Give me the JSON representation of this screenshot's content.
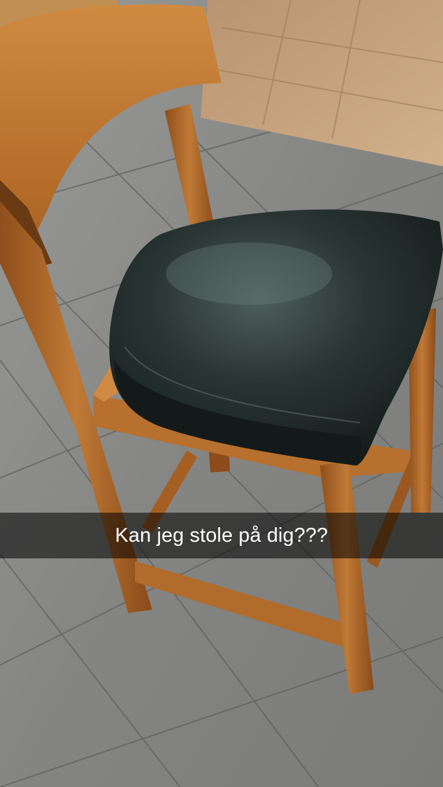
{
  "snap": {
    "caption": "Kan jeg stole på dig???"
  },
  "scene": {
    "subject": "wooden-chair-with-black-leather-cushion",
    "colors": {
      "floor_tile": "#8c8c8a",
      "floor_tile_dark": "#6f6f6d",
      "parquet": "#c4a27a",
      "wood": "#b06a2c",
      "wood_dark": "#7a4216",
      "cushion": "#1f2a28",
      "cushion_highlight": "#5e6f6a"
    }
  }
}
